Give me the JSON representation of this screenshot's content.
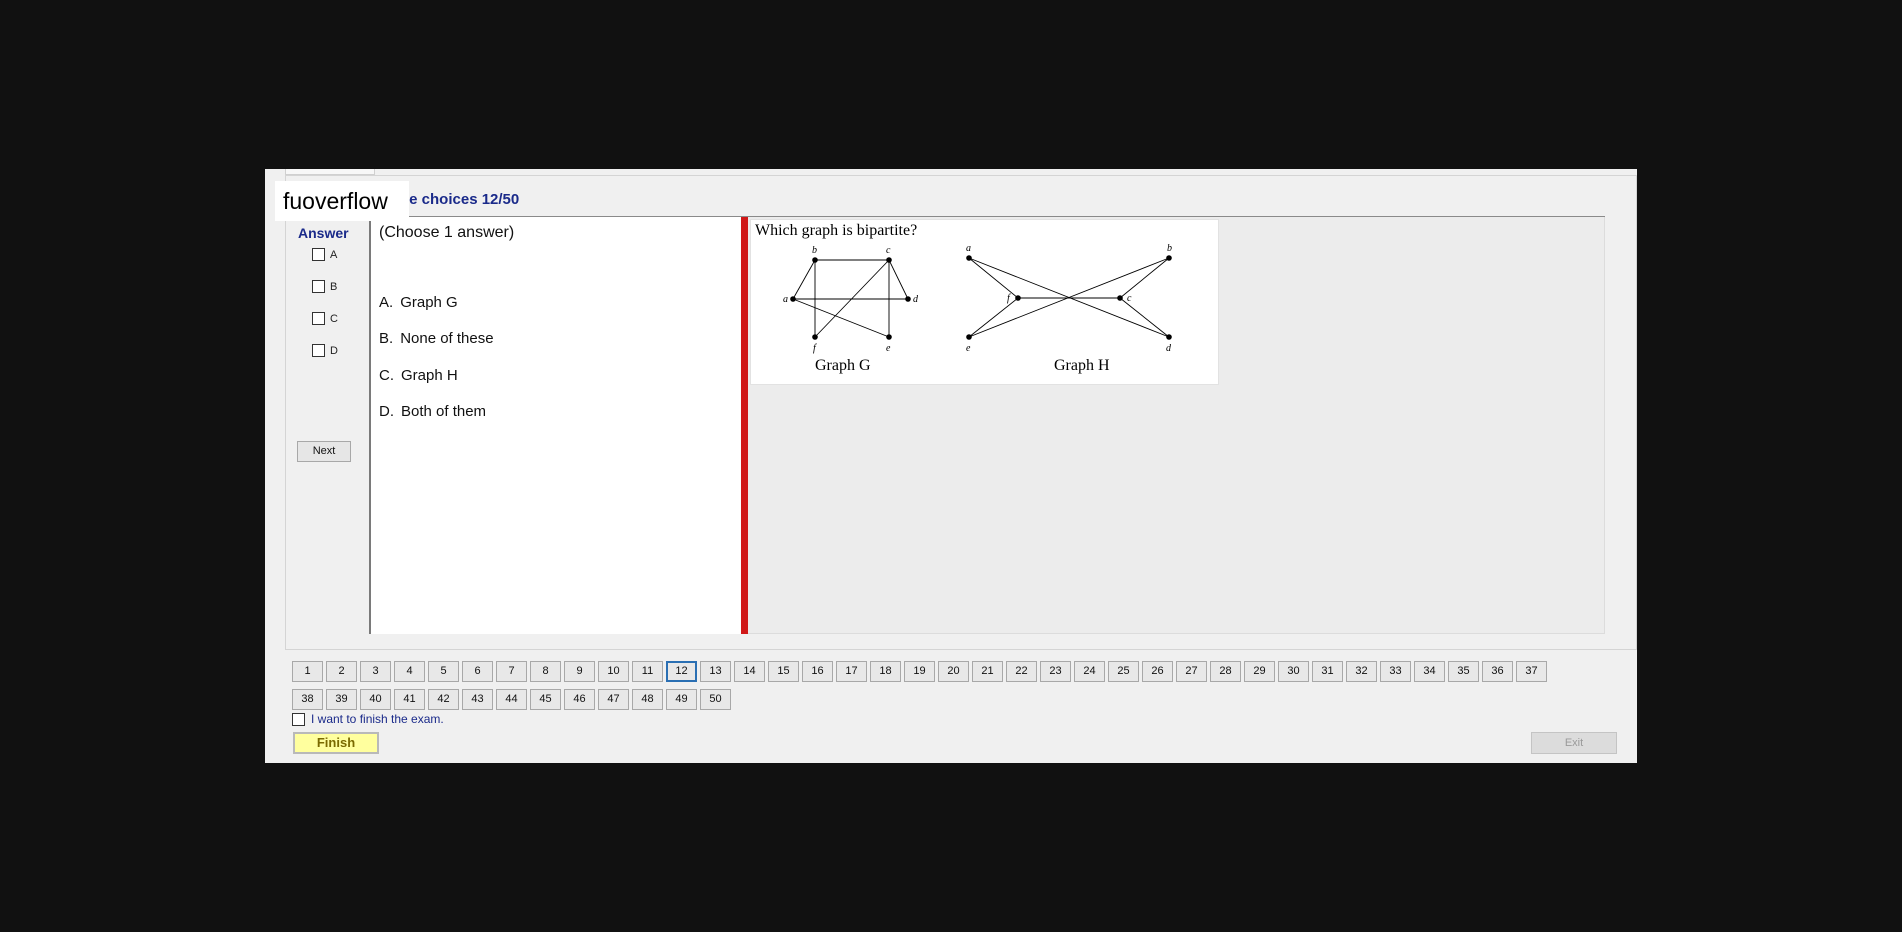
{
  "brand": {
    "name": "fuoverflow"
  },
  "section_title": "le choices 12/50",
  "answer_panel": {
    "heading": "Answer",
    "options": [
      "A",
      "B",
      "C",
      "D"
    ],
    "next_label": "Next"
  },
  "question": {
    "instruction": "(Choose 1 answer)",
    "answers": [
      {
        "letter": "A.",
        "text": "Graph G"
      },
      {
        "letter": "B.",
        "text": "None of these"
      },
      {
        "letter": "C.",
        "text": "Graph H"
      },
      {
        "letter": "D.",
        "text": "Both of them"
      }
    ]
  },
  "image": {
    "question_text": "Which graph is bipartite?",
    "graph_g": {
      "caption": "Graph G",
      "vertices": [
        "a",
        "b",
        "c",
        "d",
        "e",
        "f"
      ]
    },
    "graph_h": {
      "caption": "Graph H",
      "vertices": [
        "a",
        "b",
        "c",
        "d",
        "e",
        "f"
      ]
    }
  },
  "navigation": {
    "questions": [
      "1",
      "2",
      "3",
      "4",
      "5",
      "6",
      "7",
      "8",
      "9",
      "10",
      "11",
      "12",
      "13",
      "14",
      "15",
      "16",
      "17",
      "18",
      "19",
      "20",
      "21",
      "22",
      "23",
      "24",
      "25",
      "26",
      "27",
      "28",
      "29",
      "30",
      "31",
      "32",
      "33",
      "34",
      "35",
      "36",
      "37",
      "38",
      "39",
      "40",
      "41",
      "42",
      "43",
      "44",
      "45",
      "46",
      "47",
      "48",
      "49",
      "50"
    ],
    "current": "12"
  },
  "footer": {
    "finish_check_label": "I want to finish the exam.",
    "finish_label": "Finish",
    "exit_label": "Exit"
  },
  "colors": {
    "accent_blue": "#1a2a8a",
    "splitter_red": "#d01818",
    "finish_yellow": "#ffff9e",
    "current_outline": "#2a6fb3"
  }
}
